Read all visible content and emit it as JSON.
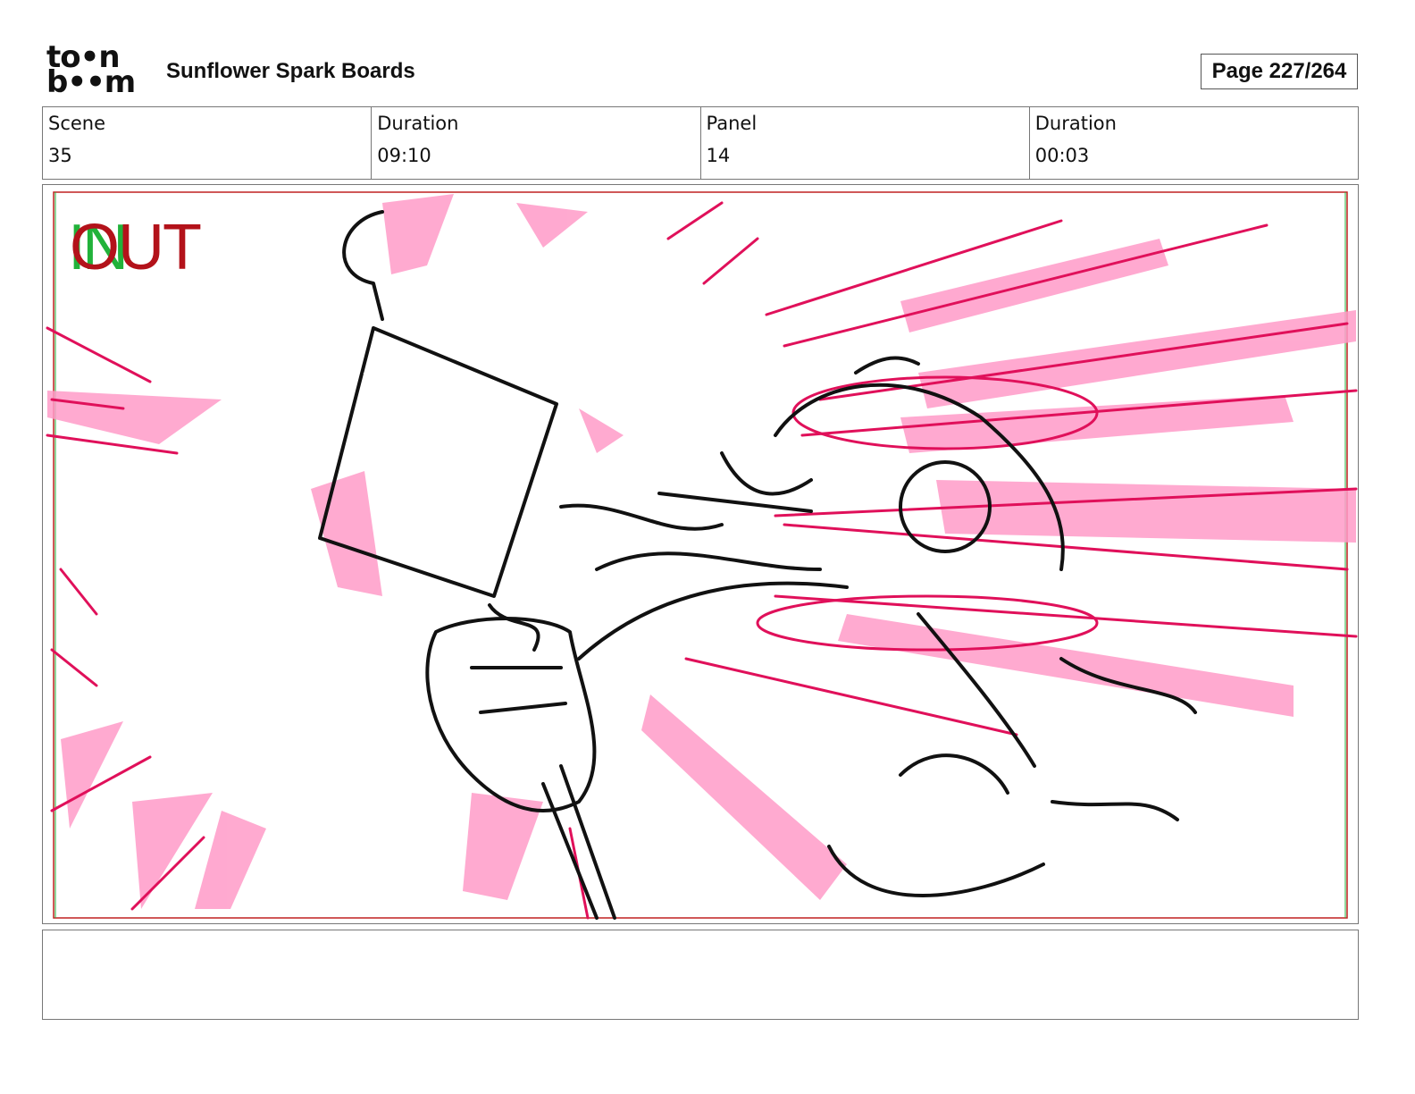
{
  "header": {
    "logo_top": "to•n",
    "logo_bottom": "b••m",
    "doc_title": "Sunflower Spark Boards",
    "page_label": "Page 227/264"
  },
  "info": {
    "scene_label": "Scene",
    "scene_value": "35",
    "scene_duration_label": "Duration",
    "scene_duration_value": "09:10",
    "panel_label": "Panel",
    "panel_value": "14",
    "panel_duration_label": "Duration",
    "panel_duration_value": "00:03"
  },
  "panel": {
    "in_marker": "IN",
    "out_marker": "OUT",
    "colors": {
      "sketch_pink": "#ff9bc8",
      "sketch_magenta": "#e0105a",
      "line": "#111111",
      "in_green": "#21b23a",
      "out_red": "#b3121a"
    }
  },
  "notes": {
    "text": ""
  }
}
